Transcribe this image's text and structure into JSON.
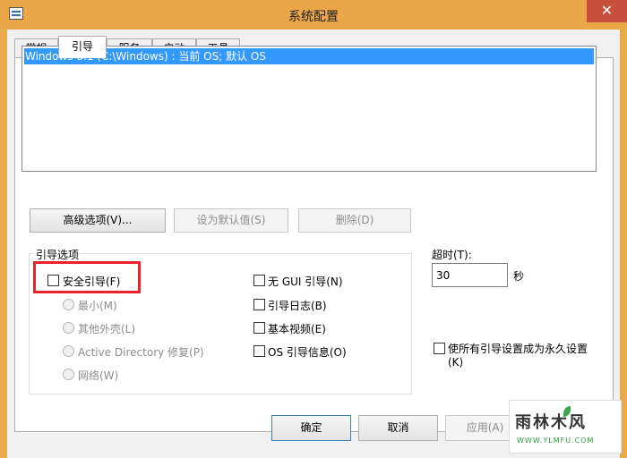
{
  "window": {
    "title": "系统配置",
    "close_label": "✕"
  },
  "tabs": [
    {
      "label": "常规"
    },
    {
      "label": "引导"
    },
    {
      "label": "服务"
    },
    {
      "label": "启动"
    },
    {
      "label": "工具"
    }
  ],
  "active_tab": "引导",
  "os_list": {
    "items": [
      "Windows 8.1 (C:\\Windows) : 当前 OS; 默认 OS"
    ],
    "selected_index": 0
  },
  "buttons": {
    "advanced": "高级选项(V)...",
    "set_default": "设为默认值(S)",
    "delete": "删除(D)"
  },
  "boot_options": {
    "group_label": "引导选项",
    "safe_boot": "安全引导(F)",
    "minimal": "最小(M)",
    "alternate_shell": "其他外壳(L)",
    "active_directory": "Active Directory 修复(P)",
    "network": "网络(W)",
    "no_gui_boot": "无 GUI 引导(N)",
    "boot_log": "引导日志(B)",
    "base_video": "基本视频(E)",
    "os_boot_info": "OS 引导信息(O)"
  },
  "timeout": {
    "label": "超时(T):",
    "value": "30",
    "unit": "秒"
  },
  "make_permanent": {
    "line1": "使所有引导设置成为永久设置",
    "line2": "(K)"
  },
  "dialog_buttons": {
    "ok": "确定",
    "cancel": "取消",
    "apply": "应用(A)"
  },
  "watermark": {
    "main": "雨林木风",
    "sub": "WWW.YLMFU.COM"
  },
  "colors": {
    "title_bar": "#eaa647",
    "close_button": "#c7503d",
    "selection": "#3399ff",
    "highlight_box": "#e8232b"
  }
}
